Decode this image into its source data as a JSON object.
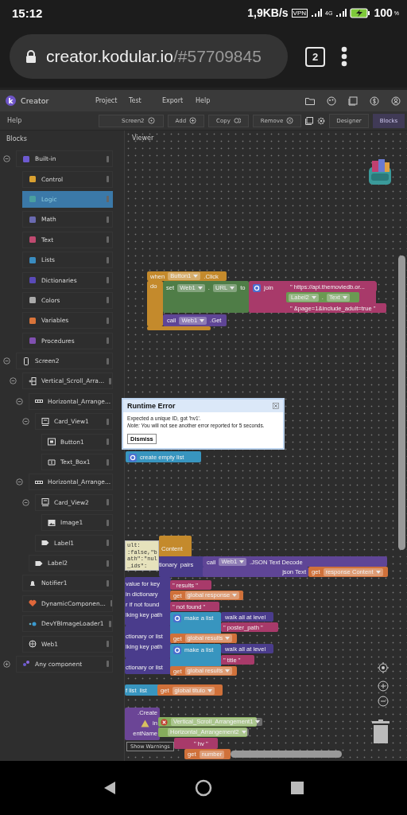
{
  "status_bar": {
    "time": "15:12",
    "speed": "1,9KB/s",
    "vpn": "VPN",
    "network": "4G",
    "battery": "100",
    "battery_unit": "%"
  },
  "browser": {
    "domain": "creator.kodular.io",
    "path": "/#57709845",
    "tab_count": "2"
  },
  "app": {
    "logo": "k",
    "title": "Creator",
    "menu": [
      "Project",
      "Test",
      "Export",
      "Help"
    ]
  },
  "toolbar": {
    "help": "Help",
    "buttons": [
      {
        "label": "Screen2",
        "kind": "select"
      },
      {
        "label": "Add",
        "kind": "add"
      },
      {
        "label": "Copy",
        "kind": "copy"
      },
      {
        "label": "Remove",
        "kind": "remove"
      }
    ],
    "views": [
      {
        "label": "Designer",
        "selected": false
      },
      {
        "label": "Blocks",
        "selected": true
      }
    ]
  },
  "sidebar": {
    "title": "Blocks",
    "items": [
      {
        "label": "Built-in",
        "kind": "builtin",
        "expanded": true,
        "selected": false,
        "children": [
          {
            "label": "Control",
            "kind": "control",
            "selected": false
          },
          {
            "label": "Logic",
            "kind": "logic",
            "selected": true
          },
          {
            "label": "Math",
            "kind": "math",
            "selected": false
          },
          {
            "label": "Text",
            "kind": "text",
            "selected": false
          },
          {
            "label": "Lists",
            "kind": "lists",
            "selected": false
          },
          {
            "label": "Dictionaries",
            "kind": "dictionaries",
            "selected": false
          },
          {
            "label": "Colors",
            "kind": "colors",
            "selected": false
          },
          {
            "label": "Variables",
            "kind": "variables",
            "selected": false
          },
          {
            "label": "Procedures",
            "kind": "procedures",
            "selected": false
          }
        ]
      },
      {
        "label": "Screen2",
        "kind": "screen",
        "expanded": true,
        "selected": false,
        "children": [
          {
            "label": "Vertical_Scroll_Arra...",
            "kind": "vertical",
            "expanded": true,
            "selected": false,
            "children": [
              {
                "label": "Horizontal_Arrange...",
                "kind": "horizontal",
                "expanded": true,
                "selected": false,
                "children": [
                  {
                    "label": "Card_View1",
                    "kind": "card",
                    "expanded": true,
                    "selected": false,
                    "children": [
                      {
                        "label": "Button1",
                        "kind": "button",
                        "selected": false
                      },
                      {
                        "label": "Text_Box1",
                        "kind": "textbox",
                        "selected": false
                      }
                    ]
                  }
                ]
              },
              {
                "label": "Horizontal_Arrange...",
                "kind": "horizontal",
                "expanded": true,
                "selected": false,
                "children": [
                  {
                    "label": "Card_View2",
                    "kind": "card",
                    "expanded": true,
                    "selected": false,
                    "children": [
                      {
                        "label": "Image1",
                        "kind": "image",
                        "selected": false
                      }
                    ]
                  },
                  {
                    "label": "Label1",
                    "kind": "label",
                    "selected": false
                  }
                ]
              },
              {
                "label": "Label2",
                "kind": "label",
                "selected": false
              }
            ]
          },
          {
            "label": "Notifier1",
            "kind": "notifier",
            "selected": false
          },
          {
            "label": "DynamicComponen...",
            "kind": "dynamic",
            "selected": false
          },
          {
            "label": "DevYBImageLoader1",
            "kind": "loader",
            "selected": false
          },
          {
            "label": "Web1",
            "kind": "web",
            "selected": false
          }
        ]
      },
      {
        "label": "Any component",
        "kind": "any",
        "expanded": false,
        "selected": false
      }
    ]
  },
  "viewer": {
    "title": "Viewer",
    "blocks": [
      {
        "kind": "event",
        "rows": [
          [
            {
              "kind": "label",
              "text": "when"
            },
            {
              "kind": "dropdown",
              "text": "Button1"
            },
            {
              "kind": "label",
              "text": ".Click"
            }
          ],
          [
            {
              "kind": "label",
              "text": "do"
            }
          ]
        ]
      },
      {
        "kind": "setter",
        "rows": [
          [
            {
              "kind": "label",
              "text": "set"
            },
            {
              "kind": "dropdown",
              "text": "Web1"
            },
            {
              "kind": "label",
              "text": "."
            },
            {
              "kind": "dropdown",
              "text": "URL"
            },
            {
              "kind": "label",
              "text": "to"
            }
          ]
        ]
      },
      {
        "kind": "text",
        "rows": [
          [
            {
              "kind": "gear"
            },
            {
              "kind": "label",
              "text": "join"
            }
          ]
        ]
      },
      {
        "kind": "text",
        "rows": [
          [
            {
              "kind": "string",
              "text": "\" https://api.themoviedb.or..."
            }
          ]
        ]
      },
      {
        "kind": "getter",
        "rows": [
          [
            {
              "kind": "dropdown",
              "text": "Label2"
            },
            {
              "kind": "label",
              "text": "."
            },
            {
              "kind": "dropdown",
              "text": "Text"
            }
          ]
        ]
      },
      {
        "kind": "text",
        "rows": [
          [
            {
              "kind": "string",
              "text": "\" &page=1&include_adult=true \""
            }
          ]
        ]
      },
      {
        "kind": "method",
        "rows": [
          [
            {
              "kind": "label",
              "text": "call"
            },
            {
              "kind": "dropdown",
              "text": "Web1"
            },
            {
              "kind": "label",
              "text": ".Get"
            }
          ]
        ]
      },
      {
        "kind": "list",
        "rows": [
          [
            {
              "kind": "gear"
            },
            {
              "kind": "label",
              "text": "create empty list"
            }
          ]
        ]
      },
      {
        "kind": "event",
        "rows": [
          [
            {
              "kind": "label",
              "text": "Content"
            }
          ]
        ]
      },
      {
        "kind": "dictionary",
        "rows": [
          [
            {
              "kind": "label",
              "text": "tionary"
            },
            {
              "kind": "label",
              "text": "pairs"
            }
          ]
        ]
      },
      {
        "kind": "method",
        "rows": [
          [
            {
              "kind": "label",
              "text": "call"
            },
            {
              "kind": "dropdown",
              "text": "Web1"
            },
            {
              "kind": "label",
              "text": ".JSON Text Decode"
            }
          ]
        ]
      },
      {
        "kind": "method",
        "rows": [
          [
            {
              "kind": "label",
              "text": "json Text"
            }
          ]
        ]
      },
      {
        "kind": "variable",
        "rows": [
          [
            {
              "kind": "label",
              "text": "get"
            },
            {
              "kind": "dropdown",
              "text": "response Content"
            }
          ]
        ]
      },
      {
        "kind": "dictionary",
        "rows": [
          [
            {
              "kind": "label",
              "text": "value for key"
            }
          ],
          [
            {
              "kind": "label",
              "text": "in dictionary"
            }
          ],
          [
            {
              "kind": "label",
              "text": "r if not found"
            }
          ],
          [
            {
              "kind": "label",
              "text": "lking key path"
            }
          ]
        ]
      },
      {
        "kind": "dictionary",
        "rows": [
          [
            {
              "kind": "label",
              "text": "ctionary or list"
            }
          ],
          [
            {
              "kind": "label",
              "text": "lking key path"
            }
          ]
        ]
      },
      {
        "kind": "dictionary",
        "rows": [
          [
            {
              "kind": "label",
              "text": "ctionary or list"
            }
          ]
        ]
      },
      {
        "kind": "text",
        "rows": [
          [
            {
              "kind": "string",
              "text": "\" results \""
            }
          ]
        ]
      },
      {
        "kind": "variable",
        "rows": [
          [
            {
              "kind": "label",
              "text": "get"
            },
            {
              "kind": "dropdown",
              "text": "global response"
            }
          ]
        ]
      },
      {
        "kind": "text",
        "rows": [
          [
            {
              "kind": "string",
              "text": "\" not found \""
            }
          ]
        ]
      },
      {
        "kind": "list",
        "rows": [
          [
            {
              "kind": "gear"
            },
            {
              "kind": "label",
              "text": "make a list"
            }
          ]
        ]
      },
      {
        "kind": "dictionary",
        "rows": [
          [
            {
              "kind": "label",
              "text": "walk all at level"
            }
          ]
        ]
      },
      {
        "kind": "text",
        "rows": [
          [
            {
              "kind": "string",
              "text": "\" poster_path \""
            }
          ]
        ]
      },
      {
        "kind": "variable",
        "rows": [
          [
            {
              "kind": "label",
              "text": "get"
            },
            {
              "kind": "dropdown",
              "text": "global results"
            }
          ]
        ]
      },
      {
        "kind": "list",
        "rows": [
          [
            {
              "kind": "gear"
            },
            {
              "kind": "label",
              "text": "make a list"
            }
          ]
        ]
      },
      {
        "kind": "dictionary",
        "rows": [
          [
            {
              "kind": "label",
              "text": "walk all at level"
            }
          ]
        ]
      },
      {
        "kind": "text",
        "rows": [
          [
            {
              "kind": "string",
              "text": "\" title \""
            }
          ]
        ]
      },
      {
        "kind": "variable",
        "rows": [
          [
            {
              "kind": "label",
              "text": "get"
            },
            {
              "kind": "dropdown",
              "text": "global results"
            }
          ]
        ]
      },
      {
        "kind": "list",
        "rows": [
          [
            {
              "kind": "label",
              "text": "f list"
            },
            {
              "kind": "label",
              "text": "list"
            }
          ]
        ]
      },
      {
        "kind": "variable",
        "rows": [
          [
            {
              "kind": "label",
              "text": "get"
            },
            {
              "kind": "dropdown",
              "text": "global titulo"
            }
          ]
        ]
      },
      {
        "kind": "create",
        "rows": [
          [
            {
              "kind": "label",
              "text": ".Create"
            }
          ],
          [
            {
              "kind": "label",
              "text": "in"
            }
          ],
          [
            {
              "kind": "label",
              "text": "entName"
            }
          ]
        ]
      },
      {
        "kind": "component",
        "rows": [
          [
            {
              "kind": "dropdown",
              "text": "Vertical_Scroll_Arrangement1"
            }
          ]
        ]
      },
      {
        "kind": "component",
        "rows": [
          [
            {
              "kind": "dropdown",
              "text": "Horizontal_Arrangement2"
            }
          ]
        ]
      },
      {
        "kind": "text",
        "rows": [
          [
            {
              "kind": "string",
              "text": "\" hv \""
            }
          ]
        ]
      },
      {
        "kind": "variable",
        "rows": [
          [
            {
              "kind": "label",
              "text": "get"
            },
            {
              "kind": "field",
              "text": "number"
            }
          ]
        ]
      }
    ],
    "comment": [
      "ult:",
      ":false,\"b",
      "ath\":\"nul",
      "_ids\":"
    ],
    "warnings_button": "Show Warnings",
    "dialog": {
      "title": "Runtime Error",
      "message": "Expected a unique ID, got 'hv1'.",
      "note": "*Note:* You will not see another error reported for 5 seconds.",
      "button": "Dismiss"
    }
  }
}
